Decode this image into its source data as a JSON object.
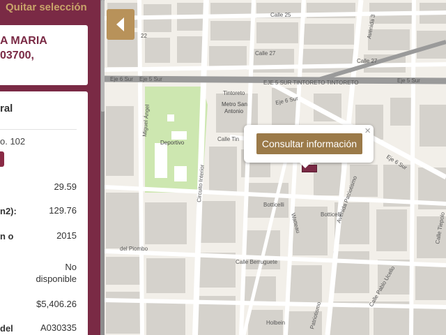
{
  "panel": {
    "quitar_label": "Quitar selección",
    "address_line1": "A MARIA",
    "address_line2": "03700,",
    "section_title": "ral",
    "no_label": "o. 102",
    "rows": [
      {
        "label": "",
        "value": "29.59"
      },
      {
        "label": "n2):",
        "value": "129.76"
      },
      {
        "label": "n o",
        "value": "2015"
      },
      {
        "label": "",
        "value_line1": "No",
        "value_line2": "disponible"
      },
      {
        "label": "",
        "value": "$5,406.26"
      },
      {
        "label": "del",
        "value": "A030335"
      }
    ]
  },
  "popup": {
    "button_label": "Consultar información",
    "close_label": "×"
  },
  "map": {
    "streets": {
      "calle25": "Calle 25",
      "calle27": "Calle 27",
      "avenida3": "Avenida 3",
      "eje6sur_left": "Eje 6 Sur",
      "eje5sur": "Eje 5 Sur",
      "tintoreto_road": "EJE 5 SUR TINTORETO TINTORETO",
      "eje5sur_right": "Eje 5 Sur",
      "tintoreto": "Tintoreto",
      "eje6sur": "Eje 6 Sur",
      "eje6sur_diag": "Eje 6 Sur",
      "calle_tin": "Calle Tin",
      "miguel_angel": "Miguel Ángel",
      "circuito_interior": "Circuito Interior",
      "botticelli1": "Botticelli",
      "botticelli2": "Botticelli",
      "watteau": "Watteau",
      "avenida_patriotismo": "Avenida Patriotismo",
      "del_piombo": "del Piombo",
      "calle_berruguete": "Calle Berruguete",
      "calle_pablo_ucello": "Calle Pablo Ucello",
      "patriotismo": "Patriotismo",
      "holbein": "Holbein",
      "tiepolo": "Calle Tiepolo",
      "num22": "22"
    },
    "places": {
      "metro_san_antonio_1": "Metro San",
      "metro_san_antonio_2": "Antonio",
      "deportivo": "Deportivo"
    },
    "colors": {
      "park": "#cde7b0",
      "building": "#d5d2cc",
      "road": "#ffffff",
      "highway": "#9a9a9a",
      "marker": "#7a2a45"
    }
  }
}
